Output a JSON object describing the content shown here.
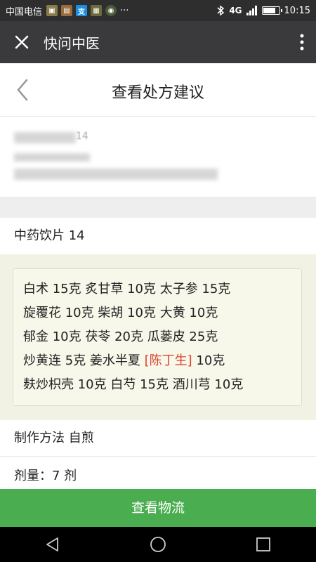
{
  "statusbar": {
    "carrier": "中国电信",
    "network": "4G",
    "time": "10:15",
    "battery_level": 0.85,
    "app_icons": [
      "gallery-icon",
      "lock-icon",
      "alipay-icon",
      "photo-icon",
      "game-icon"
    ],
    "more": "···"
  },
  "appbar": {
    "title": "快问中医"
  },
  "page": {
    "title": "查看处方建议"
  },
  "patient": {
    "age_fragment": "14"
  },
  "prescription": {
    "header": "中药饮片 14",
    "lines": [
      [
        {
          "text": "白术 15克 炙甘草 10克 太子参 15克"
        }
      ],
      [
        {
          "text": "旋覆花 10克 柴胡 10克 大黄 10克"
        }
      ],
      [
        {
          "text": "郁金 10克 茯苓 20克 瓜蒌皮 25克"
        }
      ],
      [
        {
          "text": "炒黄连 5克 姜水半夏 "
        },
        {
          "text": "[陈丁生]",
          "highlight": true
        },
        {
          "text": " 10克"
        }
      ],
      [
        {
          "text": "麸炒枳壳 10克 白芍 15克 酒川芎 10克"
        }
      ]
    ],
    "highlight_color": "#d9452f"
  },
  "method": {
    "text": "制作方法 自煎"
  },
  "dosage": {
    "text": "剂量：7 剂"
  },
  "action": {
    "label": "查看物流",
    "color": "#4aad4f"
  }
}
